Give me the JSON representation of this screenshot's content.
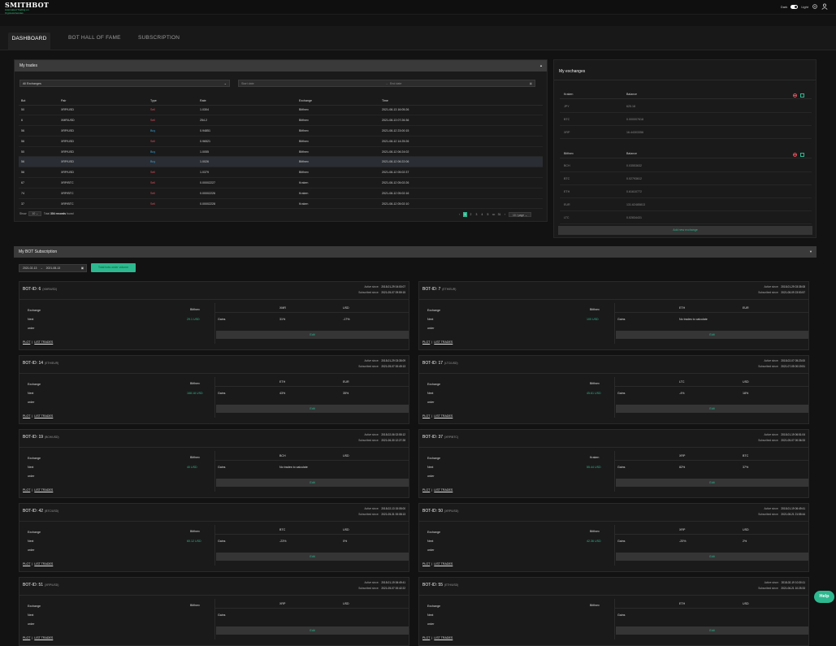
{
  "app": {
    "logo": "SMITHBOT",
    "logo_sub": "Automated Trading on Cryptocurrencies",
    "dark_label": "Dark",
    "light_label": "Light"
  },
  "tabs": [
    {
      "label": "DASHBOARD"
    },
    {
      "label": "BOT HALL OF FAME"
    },
    {
      "label": "SUBSCRIPTION"
    }
  ],
  "trades": {
    "title": "My trades",
    "exchange_select": "All Exchanges",
    "start_placeholder": "Start date",
    "end_placeholder": "End date",
    "columns": [
      "Bot",
      "Pair",
      "Type",
      "Rate",
      "Exchange",
      "Time"
    ],
    "rows": [
      [
        "50",
        "XRP/USD",
        "Sell",
        "1.0304",
        "Bitfinex",
        "2021-08-13 16:05:26"
      ],
      [
        "6",
        "XMR/USD",
        "Sell",
        "254.2",
        "Bitfinex",
        "2021-08-13 07:26:36"
      ],
      [
        "56",
        "XRP/USD",
        "Buy",
        "0.94851",
        "Bitfinex",
        "2021-08-12 23:00:15"
      ],
      [
        "56",
        "XRP/USD",
        "Sell",
        "0.96521",
        "Bitfinex",
        "2021-08-12 14:25:26"
      ],
      [
        "50",
        "XRP/USD",
        "Buy",
        "1.0055",
        "Bitfinex",
        "2021-08-12 06:24:02"
      ],
      [
        "56",
        "XRP/USD",
        "Buy",
        "1.0026",
        "Bitfinex",
        "2021-08-12 06:22:06"
      ],
      [
        "56",
        "XRP/USD",
        "Sell",
        "1.0379",
        "Bitfinex",
        "2021-08-12 05:02:37"
      ],
      [
        "67",
        "XRP/BTC",
        "Sell",
        "0.00002227",
        "Kraken",
        "2021-08-12 05:02:26"
      ],
      [
        "74",
        "XRP/BTC",
        "Sell",
        "0.00002226",
        "Kraken",
        "2021-08-12 05:02:16"
      ],
      [
        "37",
        "XRP/BTC",
        "Sell",
        "0.00002228",
        "Kraken",
        "2021-08-12 05:02:10"
      ]
    ],
    "show_label": "Show",
    "page_size": "10",
    "total_prefix": "Total",
    "total_count": "304 records",
    "total_suffix": "found",
    "pages": [
      "1",
      "2",
      "3",
      "4",
      "5",
      "•••",
      "31"
    ],
    "per_page": "10 / page"
  },
  "exchanges": {
    "title": "My exchanges",
    "groups": [
      {
        "name": "Kraken",
        "balance_label": "Balance",
        "rows": [
          [
            "JPY",
            "625.18"
          ],
          [
            "BTC",
            "0.000007618"
          ],
          [
            "XRP",
            "16.44303356"
          ]
        ]
      },
      {
        "name": "Bitfinex",
        "balance_label": "Balance",
        "rows": [
          [
            "BCH",
            "0.03553632"
          ],
          [
            "BTC",
            "0.02793612"
          ],
          [
            "ETH",
            "0.61610772"
          ],
          [
            "EUR",
            "131.62485813"
          ],
          [
            "LTC",
            "0.02834431"
          ]
        ]
      }
    ],
    "add_button": "Add new exchange"
  },
  "subscription": {
    "title": "My BOT Subscription",
    "date_from": "2021-02-13",
    "date_to": "2021-08-13",
    "total_btn": "Total bots order volume",
    "labels": {
      "exchange": "Exchange",
      "next": "Next",
      "order": "order",
      "gains": "Gains",
      "edit": "Edit",
      "plot": "PLOT",
      "list": "LIST TRADES",
      "active": "Active since:",
      "subscribed": "Subscribed since:"
    },
    "bots": [
      {
        "id": "BOT-ID: 6",
        "pair": "(XMR/USD)",
        "active": "2018-01-29 04:00:07",
        "sub": "2021-05-07 09:59:15",
        "exchange": "Bitfinex",
        "next": "29.1 USD",
        "c1": "XMR",
        "c2": "USD",
        "g1": "31%",
        "g2": "-17%",
        "note": ""
      },
      {
        "id": "BOT-ID: 7",
        "pair": "(ETH/EUR)",
        "active": "2018-01-29 03:35:08",
        "sub": "2021-08-09 23:53:57",
        "exchange": "Bitfinex",
        "next": "100 USD",
        "c1": "ETH",
        "c2": "EUR",
        "g1": "",
        "g2": "",
        "note": "No trades to calculate"
      },
      {
        "id": "BOT-ID: 14",
        "pair": "(ETH/EUR)",
        "active": "2018-01-29 03:35:09",
        "sub": "2021-05-07 00:49:13",
        "exchange": "Bitfinex",
        "next": "168.18 USD",
        "c1": "ETH",
        "c2": "EUR",
        "g1": "43%",
        "g2": "35%",
        "note": ""
      },
      {
        "id": "BOT-ID: 17",
        "pair": "(LTC/USD)",
        "active": "2018-02-07 05:23:00",
        "sub": "2021-07-05 00:19:51",
        "exchange": "Bitfinex",
        "next": "45.61 USD",
        "c1": "LTC",
        "c2": "USD",
        "g1": "-4%",
        "g2": "18%",
        "note": ""
      },
      {
        "id": "BOT-ID: 19",
        "pair": "(BCH/USD)",
        "active": "2018-02-06 02:55:12",
        "sub": "2021-06-30 12:27:28",
        "exchange": "Bitfinex",
        "next": "40 USD",
        "c1": "BCH",
        "c2": "USD",
        "g1": "",
        "g2": "",
        "note": "No trades to calculate"
      },
      {
        "id": "BOT-ID: 37",
        "pair": "(XRP/BTC)",
        "active": "2018-01-19 06:51:04",
        "sub": "2021-05-07 00:36:33",
        "exchange": "Kraken",
        "next": "55.44 USD",
        "c1": "XRP",
        "c2": "BTC",
        "g1": "82%",
        "g2": "37%",
        "note": ""
      },
      {
        "id": "BOT-ID: 42",
        "pair": "(BTC/USD)",
        "active": "2018-02-13 15:05:00",
        "sub": "2021-05-31 00:08:13",
        "exchange": "Bitfinex",
        "next": "60.12 USD",
        "c1": "BTC",
        "c2": "USD",
        "g1": "-23%",
        "g2": "0%",
        "note": ""
      },
      {
        "id": "BOT-ID: 50",
        "pair": "(XRP/USD)",
        "active": "2018-01-19 06:49:41",
        "sub": "2021-08-21 21:55:44",
        "exchange": "Bitfinex",
        "next": "42.36 USD",
        "c1": "XRP",
        "c2": "USD",
        "g1": "-20%",
        "g2": "2%",
        "note": ""
      },
      {
        "id": "BOT-ID: 51",
        "pair": "(XRP/USD)",
        "active": "2018-01-19 06:49:41",
        "sub": "2021-05-07 00:42:22",
        "exchange": "Bitfinex",
        "next": "",
        "c1": "XRP",
        "c2": "USD",
        "g1": "",
        "g2": "",
        "note": ""
      },
      {
        "id": "BOT-ID: 55",
        "pair": "(ETH/USD)",
        "active": "2018-02-19 10:30:11",
        "sub": "2021-06-21 10:25:33",
        "exchange": "Bitfinex",
        "next": "",
        "c1": "ETH",
        "c2": "USD",
        "g1": "",
        "g2": "",
        "note": ""
      }
    ]
  },
  "help": "Help"
}
